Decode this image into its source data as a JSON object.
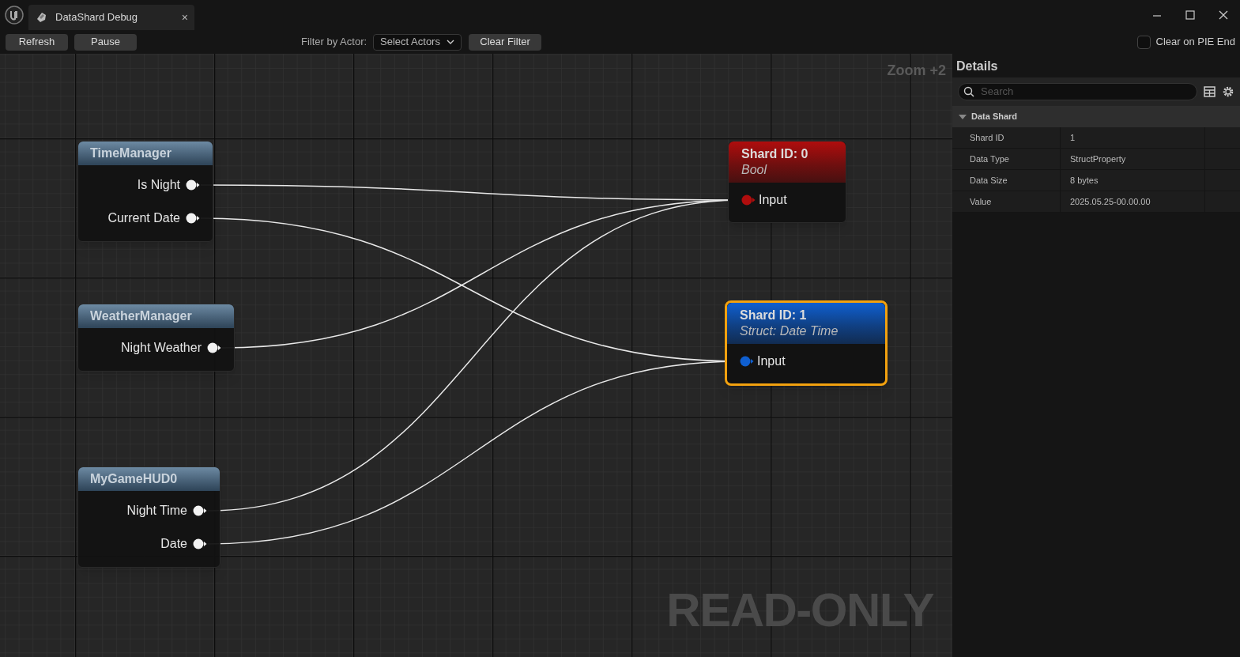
{
  "tab": {
    "title": "DataShard Debug",
    "close": "×"
  },
  "toolbar": {
    "buttons": [
      "Refresh",
      "Pause"
    ],
    "filter_label": "Filter by Actor:",
    "filter_dropdown": "Select Actors",
    "clear_button": "Clear Filter",
    "clear_on_pie_end": {
      "label": "Clear on PIE End",
      "checked": false
    }
  },
  "graph": {
    "zoom_label": "Zoom +2",
    "mode_label": "READ-ONLY",
    "actors": [
      {
        "title": "TimeManager",
        "outputs": [
          {
            "label": "Is Night"
          },
          {
            "label": "Current Date"
          }
        ]
      },
      {
        "title": "WeatherManager",
        "outputs": [
          {
            "label": "Night Weather"
          }
        ]
      },
      {
        "title": "MyGameHUD0",
        "outputs": [
          {
            "label": "Night Time"
          },
          {
            "label": "Date"
          }
        ]
      }
    ],
    "shards": [
      {
        "title": "Shard ID: 0",
        "type": "Bool",
        "input": "Input",
        "color": "#b00d0d",
        "selected": false
      },
      {
        "title": "Shard ID: 1",
        "type": "Struct: Date Time",
        "input": "Input",
        "color": "#0f5fd0",
        "selected": true
      }
    ]
  },
  "details": {
    "title": "Details",
    "search": {
      "placeholder": "Search"
    },
    "section": {
      "title": "Data Shard",
      "expanded": true,
      "rows": [
        {
          "name": "Shard ID",
          "value": "1"
        },
        {
          "name": "Data Type",
          "value": "StructProperty"
        },
        {
          "name": "Data Size",
          "value": "8 bytes"
        },
        {
          "name": "Value",
          "value": "2025.05.25-00.00.00"
        }
      ]
    }
  }
}
